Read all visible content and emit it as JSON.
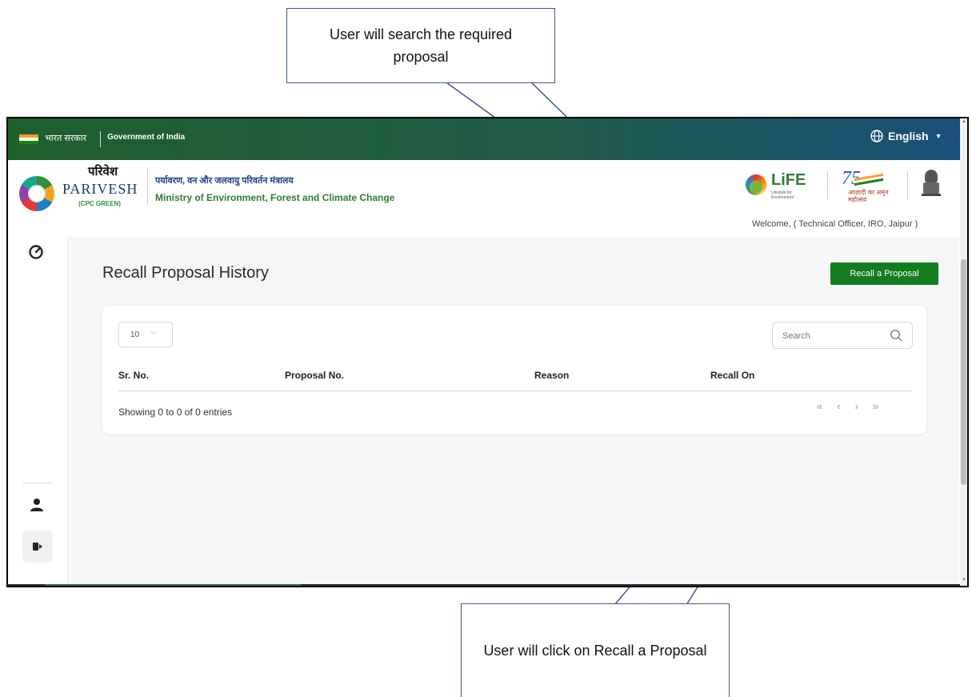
{
  "annotations": {
    "top_callout": "User will search the required proposal",
    "bottom_callout": "User will click on Recall a Proposal"
  },
  "topbar": {
    "gov_hindi": "भारत सरकार",
    "gov_english": "Government of India",
    "language": "English"
  },
  "header": {
    "brand_hindi": "परिवेश",
    "brand_english": "PARIVESH",
    "brand_sub": "(CPC GREEN)",
    "ministry_hindi": "पर्यावरण, वन और जलवायु परिवर्तन मंत्रालय",
    "ministry_english": "Ministry of Environment, Forest and Climate Change",
    "life_logo": "LiFE",
    "life_sub": "Lifestyle for Environment",
    "amrit_number": "75",
    "amrit_sub": "आज़ादी का अमृत महोत्सव",
    "welcome": "Welcome, ( Technical Officer, IRO, Jaipur )"
  },
  "page": {
    "title": "Recall Proposal History",
    "recall_button": "Recall a Proposal",
    "page_length": "10",
    "search_placeholder": "Search",
    "columns": [
      "Sr. No.",
      "Proposal No.",
      "Reason",
      "Recall On"
    ],
    "info": "Showing 0 to 0 of 0 entries",
    "pager": [
      "«",
      "‹",
      "›",
      "»"
    ]
  },
  "icons": {
    "sidebar": [
      "dashboard-speedometer-icon",
      "user-icon",
      "logout-icon"
    ],
    "language": "globe-icon",
    "search": "search-icon"
  },
  "colors": {
    "topbar_start": "#1f5f2c",
    "topbar_end": "#1b4f7a",
    "primary_button": "#137c1f",
    "ministry_english": "#2e7d32",
    "ministry_hindi": "#1a3c8a",
    "callout_border": "#3b5a86"
  }
}
